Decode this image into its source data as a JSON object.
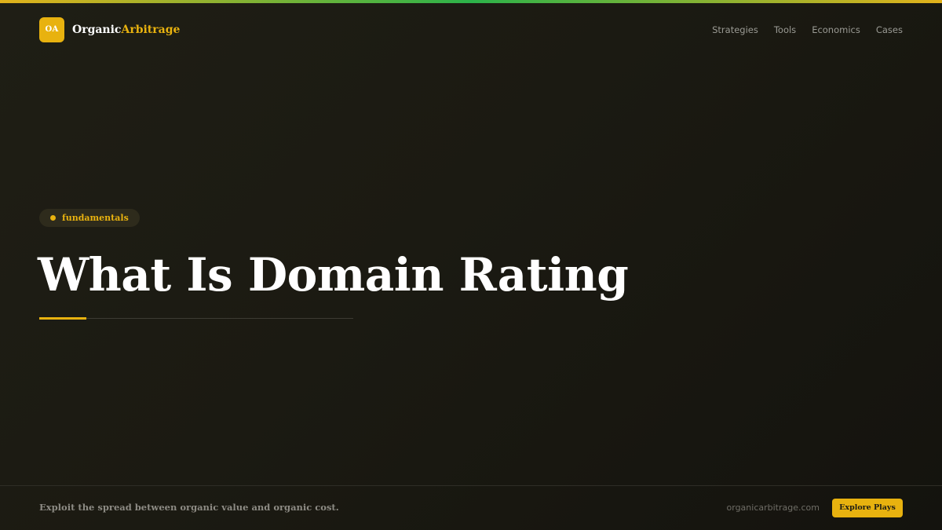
{
  "brand": {
    "badge": "OA",
    "name_part1": "Organic",
    "name_part2": "Arbitrage"
  },
  "nav": {
    "items": [
      "Strategies",
      "Tools",
      "Economics",
      "Cases"
    ]
  },
  "hero": {
    "tag": "fundamentals",
    "title": "What Is Domain Rating"
  },
  "footer": {
    "tagline": "Exploit the spread between organic value and organic cost.",
    "domain": "organicarbitrage.com",
    "cta": "Explore Plays"
  },
  "colors": {
    "accent": "#e8b20f",
    "accent_green": "#2cb34a",
    "background": "#1b1a12",
    "muted_text": "#9a9a94"
  }
}
